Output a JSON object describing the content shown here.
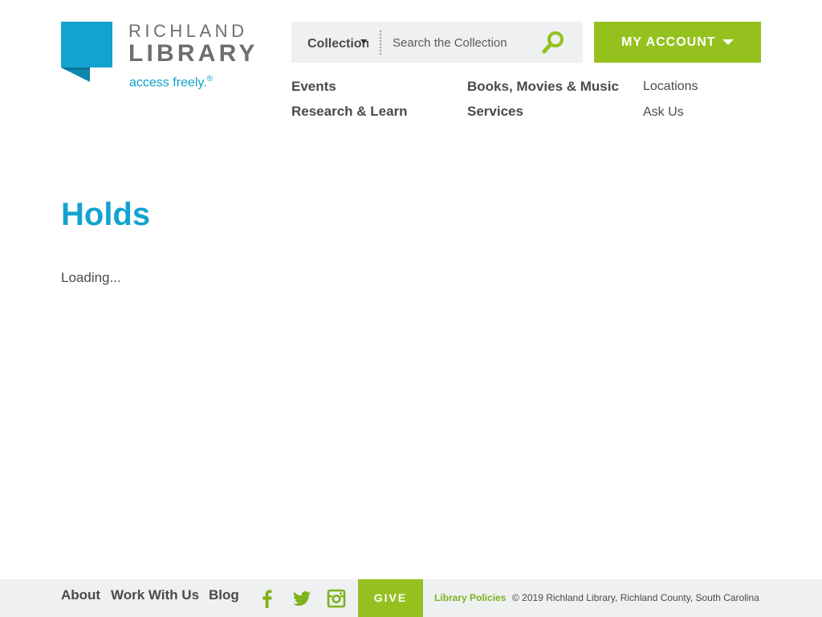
{
  "brand": {
    "name_line1": "RICHLAND",
    "name_line2": "LIBRARY",
    "tagline": "access freely.",
    "tagline_mark": "®",
    "colors": {
      "primary_blue": "#13a3cf",
      "accent_green": "#95c11f",
      "text_gray": "#4a4a4a",
      "footer_bg": "#eef0f2"
    }
  },
  "search": {
    "scope_value": "Collection",
    "placeholder": "Search the Collection",
    "button_icon": "search-icon"
  },
  "account": {
    "label": "MY ACCOUNT",
    "icon": "caret-down-icon"
  },
  "nav": {
    "events": "Events",
    "research": "Research & Learn",
    "books": "Books, Movies & Music",
    "services": "Services",
    "locations": "Locations",
    "ask": "Ask Us"
  },
  "main": {
    "title": "Holds",
    "status": "Loading..."
  },
  "footer": {
    "about": "About",
    "work": "Work With Us",
    "blog": "Blog",
    "social": [
      "facebook-icon",
      "twitter-icon",
      "instagram-icon"
    ],
    "give": "GIVE",
    "policies": "Library Policies",
    "copyright": "© 2019 Richland Library, Richland County, South Carolina"
  }
}
